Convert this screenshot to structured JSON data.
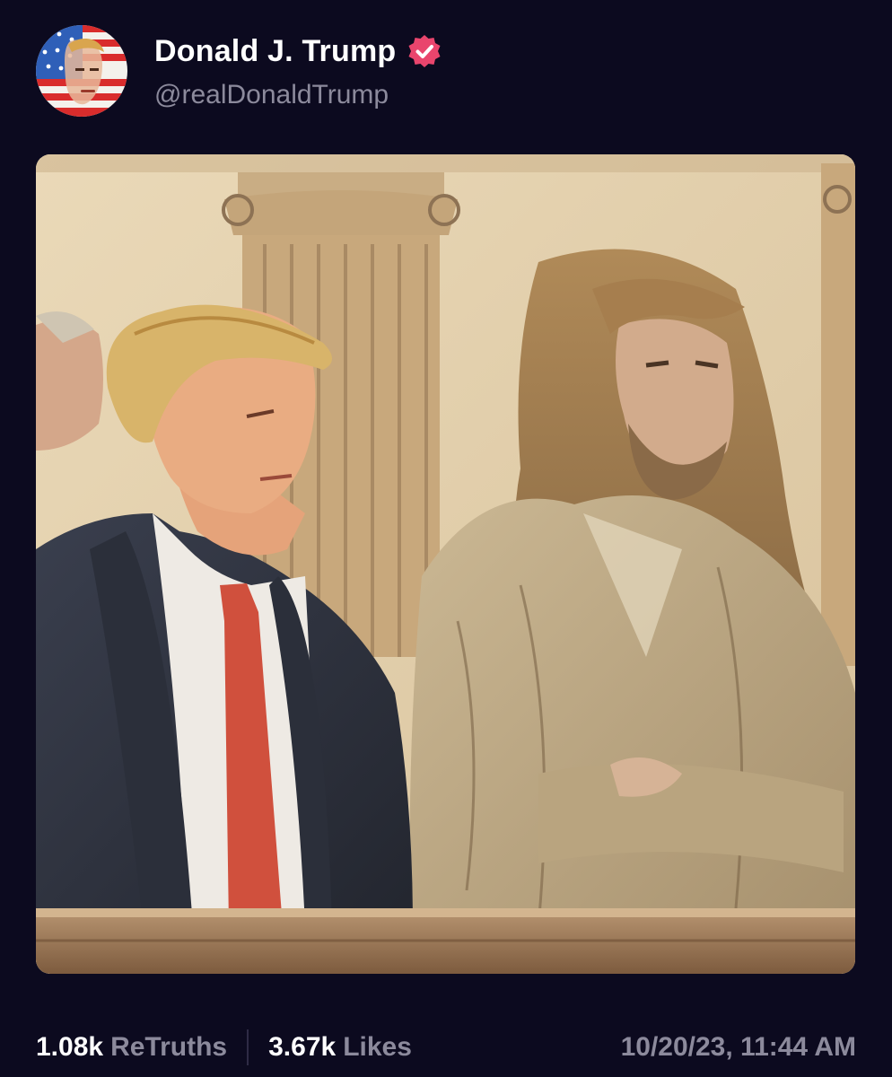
{
  "author": {
    "display_name": "Donald J. Trump",
    "handle": "@realDonaldTrump",
    "avatar_icon": "flag-portrait-avatar",
    "verified_icon": "verified-badge-icon",
    "verified_color": "#e9456d"
  },
  "media": {
    "description_icon": "courtroom-sketch-image"
  },
  "stats": {
    "retruths_count": "1.08k",
    "retruths_label": "ReTruths",
    "likes_count": "3.67k",
    "likes_label": "Likes"
  },
  "timestamp": "10/20/23, 11:44 AM",
  "colors": {
    "background": "#0c0a1f",
    "muted_text": "#8c8a9c",
    "primary_text": "#ffffff"
  }
}
